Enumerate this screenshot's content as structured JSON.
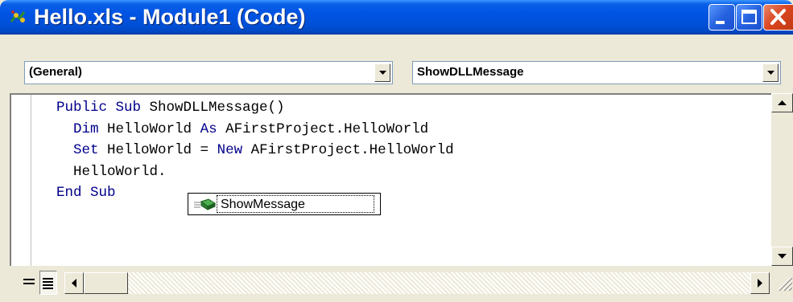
{
  "window": {
    "title": "Hello.xls - Module1 (Code)"
  },
  "combos": {
    "object": "(General)",
    "procedure": "ShowDLLMessage"
  },
  "code_lines": [
    {
      "parts": [
        {
          "t": "Public Sub",
          "k": true
        },
        {
          "t": " ShowDLLMessage()",
          "k": false
        }
      ]
    },
    {
      "parts": [
        {
          "t": "  ",
          "k": false
        },
        {
          "t": "Dim",
          "k": true
        },
        {
          "t": " HelloWorld ",
          "k": false
        },
        {
          "t": "As",
          "k": true
        },
        {
          "t": " AFirstProject.HelloWorld",
          "k": false
        }
      ]
    },
    {
      "parts": [
        {
          "t": "  ",
          "k": false
        },
        {
          "t": "Set",
          "k": true
        },
        {
          "t": " HelloWorld = ",
          "k": false
        },
        {
          "t": "New",
          "k": true
        },
        {
          "t": " AFirstProject.HelloWorld",
          "k": false
        }
      ]
    },
    {
      "parts": [
        {
          "t": "  HelloWorld.",
          "k": false
        }
      ]
    },
    {
      "parts": [
        {
          "t": "End Sub",
          "k": true
        }
      ]
    }
  ],
  "autocomplete": {
    "item": "ShowMessage",
    "icon": "method-icon"
  },
  "colors": {
    "keyword": "#00008b",
    "titlebar": "#0054e3"
  }
}
